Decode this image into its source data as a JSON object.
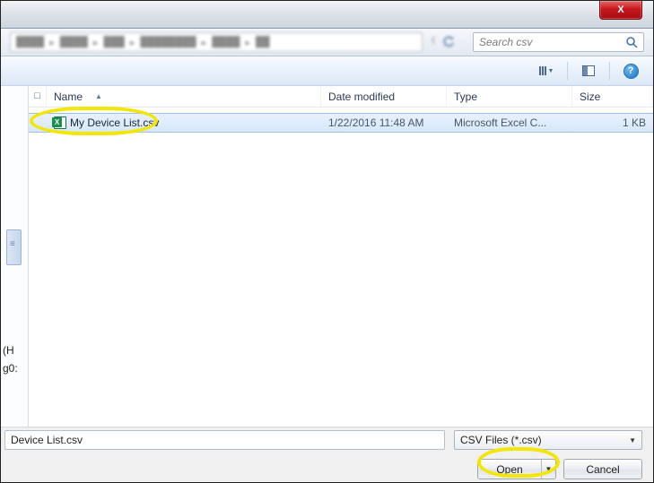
{
  "titlebar": {
    "close_glyph": "X"
  },
  "breadcrumb": {
    "items": [
      "",
      "",
      "",
      "",
      ""
    ]
  },
  "search": {
    "placeholder": "Search csv"
  },
  "toolbar": {
    "help_glyph": "?"
  },
  "columns": {
    "name": "Name",
    "date": "Date modified",
    "type": "Type",
    "size": "Size"
  },
  "files": [
    {
      "name": "My Device List.csv",
      "date": "1/22/2016 11:48 AM",
      "type": "Microsoft Excel C...",
      "size": "1 KB",
      "selected": true
    }
  ],
  "leftpane": {
    "trunc_top": "(H",
    "trunc_bottom": "g0:"
  },
  "footer": {
    "filename_value": "Device List.csv",
    "filter_label": "CSV Files (*.csv)",
    "open_label": "Open",
    "cancel_label": "Cancel"
  }
}
